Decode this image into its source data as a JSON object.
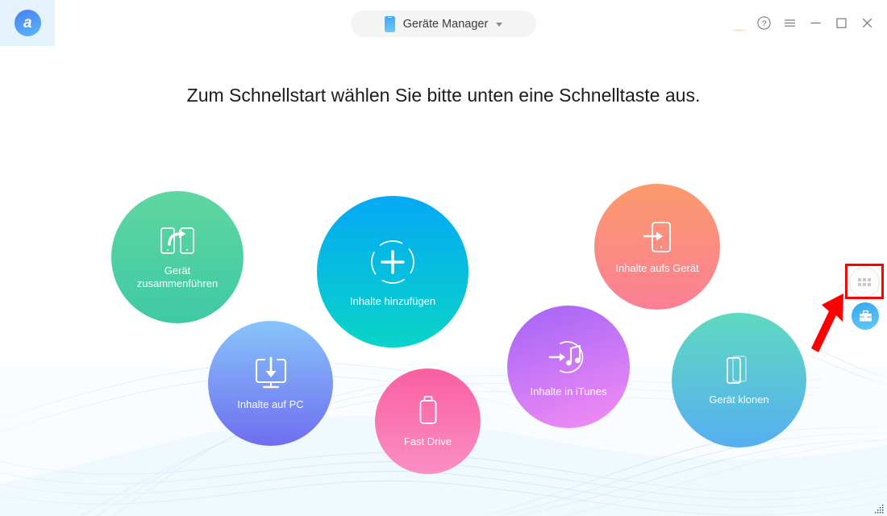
{
  "window": {
    "logo_letter": "a",
    "logo_name": "anytrans-logo"
  },
  "titlebar": {
    "device_label": "Geräte Manager",
    "device_icon": "phone-icon",
    "caret_icon": "chevron-down-icon",
    "controls": [
      {
        "name": "help-button",
        "icon": "question-circle-icon",
        "label": "?"
      },
      {
        "name": "menu-button",
        "icon": "hamburger-menu-icon",
        "label": "≡"
      },
      {
        "name": "minimize-button",
        "icon": "minimize-icon",
        "label": "—"
      },
      {
        "name": "maximize-button",
        "icon": "maximize-icon",
        "label": "□"
      },
      {
        "name": "close-button",
        "icon": "close-icon",
        "label": "✕"
      }
    ]
  },
  "main": {
    "headline": "Zum Schnellstart wählen Sie bitte unten eine Schnelltaste aus."
  },
  "bubbles": [
    {
      "label": "Gerät\nzusammenführen",
      "name": "quick-action-merge-device",
      "icon": "two-phones-transfer-icon",
      "color_start": "#5fd6a0",
      "color_end": "#3fc9a5"
    },
    {
      "label": "Inhalte hinzufügen",
      "name": "quick-action-add-content",
      "icon": "dashed-circle-plus-icon",
      "color_start": "#04a8f4",
      "color_end": "#0ad4c8"
    },
    {
      "label": "Inhalte aufs Gerät",
      "name": "quick-action-content-to-device",
      "icon": "arrow-into-phone-icon",
      "color_start": "#fb9a6c",
      "color_end": "#fb7f95"
    },
    {
      "label": "Inhalte auf PC",
      "name": "quick-action-content-to-pc",
      "icon": "monitor-download-icon",
      "color_start": "#87c4fa",
      "color_end": "#6f6ef0"
    },
    {
      "label": "Fast Drive",
      "name": "quick-action-fast-drive",
      "icon": "usb-drive-icon",
      "color_start": "#f95fa0",
      "color_end": "#fb8fc3"
    },
    {
      "label": "Inhalte in iTunes",
      "name": "quick-action-content-to-itunes",
      "icon": "arrow-into-music-circle-icon",
      "color_start": "#a263f7",
      "color_end": "#f58ef4"
    },
    {
      "label": "Gerät klonen",
      "name": "quick-action-clone-device",
      "icon": "two-phones-clone-icon",
      "color_start": "#5fd9c0",
      "color_end": "#56aff0"
    }
  ],
  "rail": {
    "grid_button_name": "apps-grid-button",
    "grid_icon": "grid-apps-icon",
    "toolbox_button_name": "toolbox-button",
    "toolbox_icon": "toolbox-icon",
    "highlight_color": "#ff0000",
    "annotation_arrow": "red-pointer-arrow"
  },
  "resize_grip": {
    "name": "resize-grip",
    "icon": "resize-grip-icon"
  }
}
